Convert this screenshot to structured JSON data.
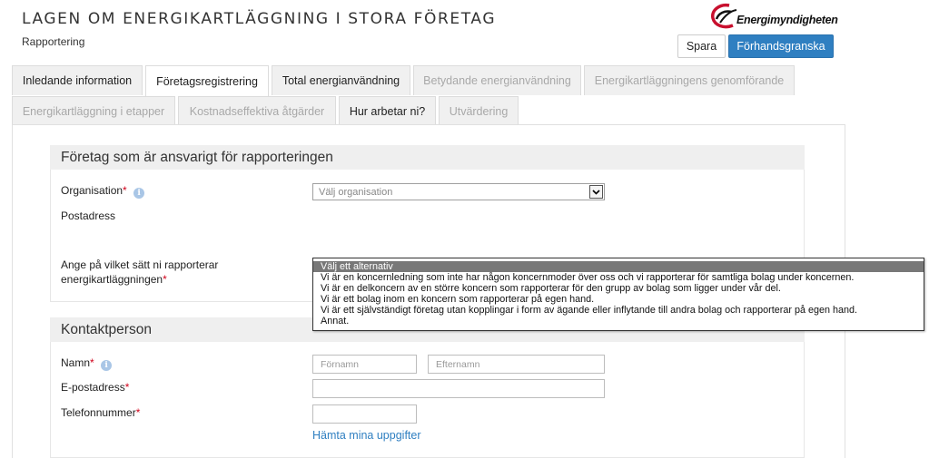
{
  "header": {
    "title": "LAGEN OM ENERGIKARTLÄGGNING I STORA FÖRETAG",
    "subtitle": "Rapportering",
    "logo_text": "Energimyndigheten",
    "save_label": "Spara",
    "preview_label": "Förhandsgranska"
  },
  "tabs": [
    {
      "label": "Inledande information",
      "state": "normal"
    },
    {
      "label": "Företagsregistrering",
      "state": "active"
    },
    {
      "label": "Total energianvändning",
      "state": "normal"
    },
    {
      "label": "Betydande energianvändning",
      "state": "disabled"
    },
    {
      "label": "Energikartläggningens genomförande",
      "state": "disabled"
    },
    {
      "label": "Energikartläggning i etapper",
      "state": "disabled"
    },
    {
      "label": "Kostnadseffektiva åtgärder",
      "state": "disabled"
    },
    {
      "label": "Hur arbetar ni?",
      "state": "normal"
    },
    {
      "label": "Utvärdering",
      "state": "disabled"
    }
  ],
  "company_section": {
    "heading": "Företag som är ansvarigt för rapporteringen",
    "organisation_label": "Organisation",
    "organisation_placeholder": "Välj organisation",
    "postal_label": "Postadress",
    "report_method_label_line1": "Ange på vilket sätt ni rapporterar",
    "report_method_label_line2": "energikartläggningen"
  },
  "dropdown": {
    "options": [
      "Välj ett alternativ",
      "Vi är en koncernledning som inte har någon koncernmoder över oss och vi rapporterar för samtliga bolag under koncernen.",
      "Vi är en delkoncern av en större koncern som rapporterar för den grupp av bolag som ligger under vår del.",
      "Vi är ett bolag inom en koncern som rapporterar på egen hand.",
      "Vi är ett självständigt företag utan kopplingar i form av ägande eller inflytande till andra bolag och rapporterar på egen hand.",
      "Annat."
    ],
    "selected_index": 0
  },
  "contact_section": {
    "heading": "Kontaktperson",
    "name_label": "Namn",
    "first_name_placeholder": "Förnamn",
    "last_name_placeholder": "Efternamn",
    "email_label": "E-postadress",
    "phone_label": "Telefonnummer",
    "fetch_link": "Hämta mina uppgifter"
  },
  "required_mark": "*",
  "colors": {
    "accent": "#2f7fc1",
    "required": "#d0021b",
    "logo_red": "#c8102e"
  }
}
